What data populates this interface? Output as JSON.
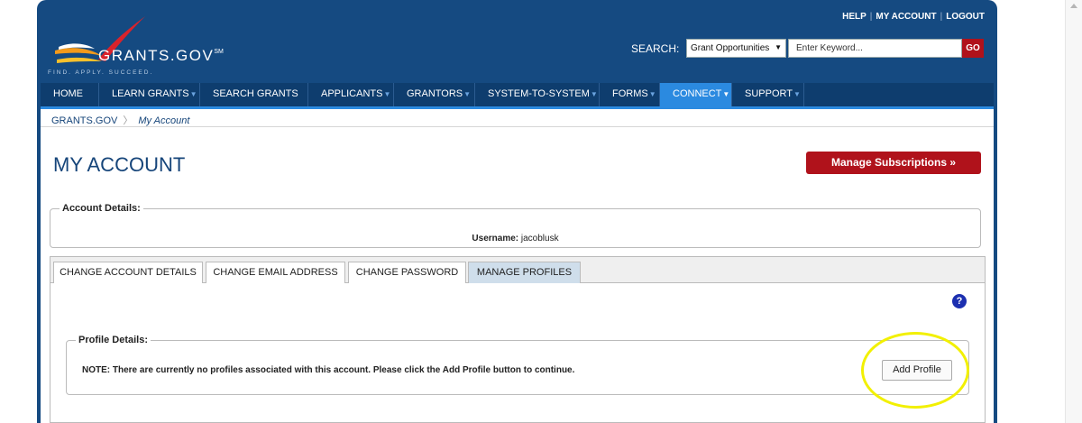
{
  "header": {
    "logo_text": "GRANTS.GOV",
    "logo_mark": "SM",
    "tagline": "FIND. APPLY. SUCCEED.",
    "util_links": [
      "HELP",
      "MY ACCOUNT",
      "LOGOUT"
    ],
    "search_label": "SEARCH:",
    "search_select_value": "Grant Opportunities",
    "search_placeholder": "Enter Keyword...",
    "go_label": "GO"
  },
  "nav": {
    "items": [
      {
        "label": "HOME",
        "dropdown": false
      },
      {
        "label": "LEARN GRANTS",
        "dropdown": true
      },
      {
        "label": "SEARCH GRANTS",
        "dropdown": false
      },
      {
        "label": "APPLICANTS",
        "dropdown": true
      },
      {
        "label": "GRANTORS",
        "dropdown": true
      },
      {
        "label": "SYSTEM-TO-SYSTEM",
        "dropdown": true
      },
      {
        "label": "FORMS",
        "dropdown": true
      },
      {
        "label": "CONNECT",
        "dropdown": true,
        "active": true
      },
      {
        "label": "SUPPORT",
        "dropdown": true
      }
    ]
  },
  "breadcrumb": {
    "root": "GRANTS.GOV",
    "current": "My Account"
  },
  "page": {
    "title": "MY ACCOUNT",
    "manage_subscriptions": "Manage Subscriptions »"
  },
  "account_details": {
    "legend": "Account Details:",
    "username_label": "Username:",
    "username_value": "jacoblusk"
  },
  "tabs": [
    {
      "label": "CHANGE ACCOUNT DETAILS",
      "active": false
    },
    {
      "label": "CHANGE EMAIL ADDRESS",
      "active": false
    },
    {
      "label": "CHANGE PASSWORD",
      "active": false
    },
    {
      "label": "MANAGE PROFILES",
      "active": true
    }
  ],
  "help_icon": "?",
  "profile_details": {
    "legend": "Profile Details:",
    "note": "NOTE: There are currently no profiles associated with this account. Please click the Add Profile button to continue.",
    "add_profile_label": "Add Profile"
  },
  "colors": {
    "header_blue": "#154a81",
    "nav_active": "#2b8ae0",
    "brand_red": "#b0121b",
    "highlight_yellow": "#f2f000"
  }
}
